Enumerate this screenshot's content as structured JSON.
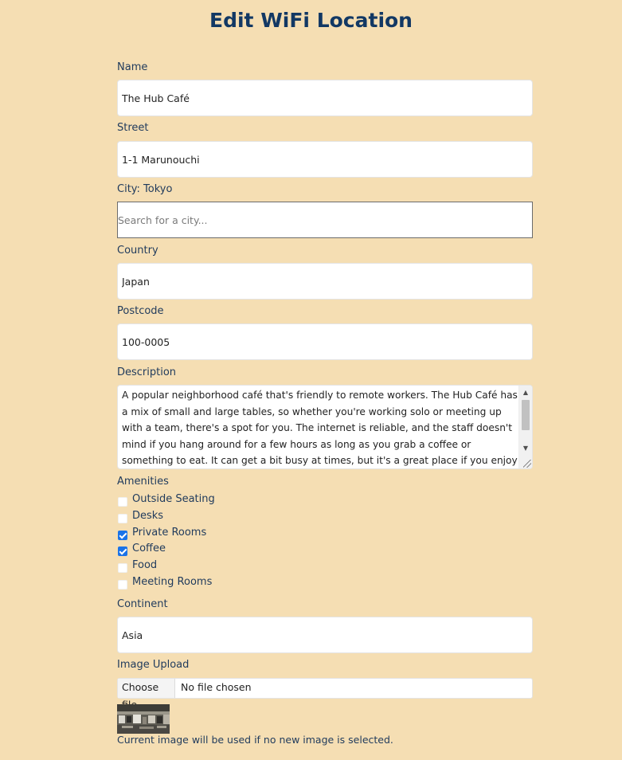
{
  "page": {
    "title": "Edit WiFi Location"
  },
  "form": {
    "name": {
      "label": "Name",
      "value": "The Hub Café"
    },
    "street": {
      "label": "Street",
      "value": "1-1 Marunouchi"
    },
    "city": {
      "label": "City: Tokyo",
      "placeholder": "Search for a city..."
    },
    "country": {
      "label": "Country",
      "value": "Japan"
    },
    "postcode": {
      "label": "Postcode",
      "value": "100-0005"
    },
    "description": {
      "label": "Description",
      "value": "A popular neighborhood café that's friendly to remote workers. The Hub Café has a mix of small and large tables, so whether you're working solo or meeting up with a team, there's a spot for you. The internet is reliable, and the staff doesn't mind if you hang around for a few hours as long as you grab a coffee or something to eat. It can get a bit busy at times, but it's a great place if you enjoy a bit of background noise while you work."
    },
    "amenities": {
      "label": "Amenities",
      "items": [
        {
          "label": "Outside Seating",
          "checked": false
        },
        {
          "label": "Desks",
          "checked": false
        },
        {
          "label": "Private Rooms",
          "checked": true
        },
        {
          "label": "Coffee",
          "checked": true
        },
        {
          "label": "Food",
          "checked": false
        },
        {
          "label": "Meeting Rooms",
          "checked": false
        }
      ]
    },
    "continent": {
      "label": "Continent",
      "value": "Asia"
    },
    "image_upload": {
      "label": "Image Upload",
      "button_label": "Choose file",
      "status": "No file chosen",
      "hint": "Current image will be used if no new image is selected."
    }
  },
  "colors": {
    "background": "#f5deb3",
    "title": "#123864",
    "label": "#1f3a5c",
    "checkbox_checked": "#1a73e8"
  },
  "icons": {
    "scroll_up": "scroll-up-arrow-icon",
    "scroll_down": "scroll-down-arrow-icon",
    "resize": "resize-grip-icon"
  }
}
